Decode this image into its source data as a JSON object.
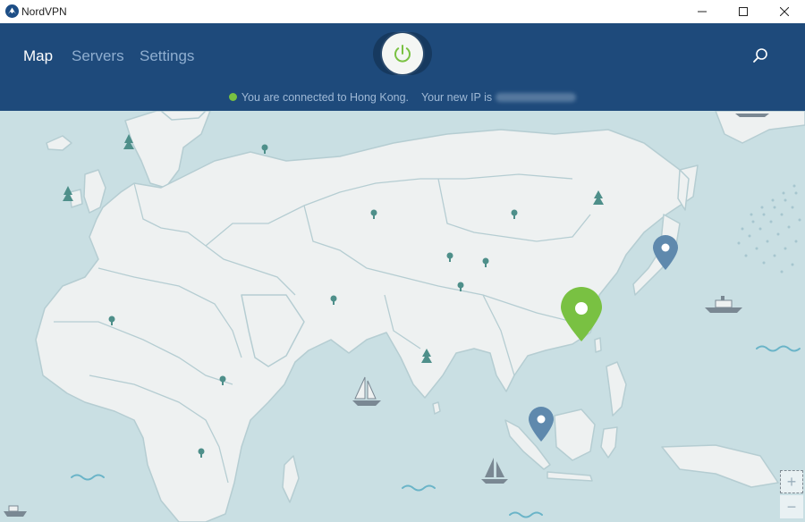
{
  "window": {
    "title": "NordVPN"
  },
  "nav": {
    "tabs": [
      {
        "label": "Map",
        "active": true
      },
      {
        "label": "Servers",
        "active": false
      },
      {
        "label": "Settings",
        "active": false
      }
    ]
  },
  "connection": {
    "status_text": "You are connected to Hong Kong.",
    "ip_label": "Your new IP is",
    "connected": true
  },
  "map": {
    "connected_pin_color": "#79c142",
    "pin_color": "#5f89ad",
    "land_color": "#eef1f1",
    "sea_color": "#c9dfe3"
  },
  "zoom": {
    "in_label": "+",
    "out_label": "−"
  },
  "colors": {
    "header": "#1e4a7b",
    "accent": "#79c142"
  }
}
